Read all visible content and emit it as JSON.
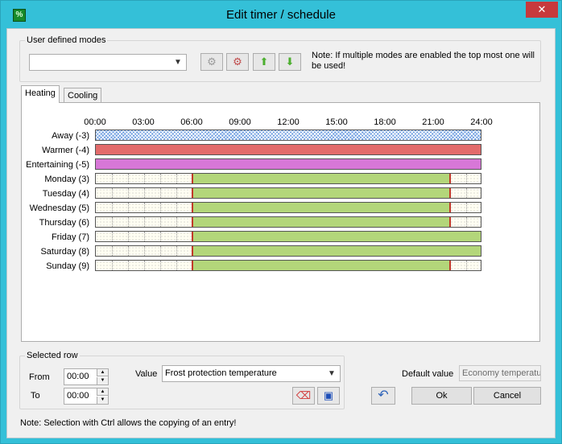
{
  "window": {
    "title": "Edit timer / schedule",
    "close_glyph": "✕",
    "app_icon_glyph": "%"
  },
  "modes": {
    "legend": "User defined modes",
    "combo_value": "",
    "note": "Note: If multiple modes are enabled the top most one will be used!",
    "buttons": [
      {
        "icon": "add-mode-icon",
        "glyph": "⚙"
      },
      {
        "icon": "delete-mode-icon",
        "glyph": "⚙"
      },
      {
        "icon": "arrow-up-icon",
        "glyph": "⬆"
      },
      {
        "icon": "arrow-down-icon",
        "glyph": "⬇"
      }
    ]
  },
  "tabs": [
    {
      "label": "Heating",
      "active": true
    },
    {
      "label": "Cooling",
      "active": false
    }
  ],
  "schedule": {
    "ticks": [
      "00:00",
      "03:00",
      "06:00",
      "09:00",
      "12:00",
      "15:00",
      "18:00",
      "21:00",
      "24:00"
    ],
    "colors": {
      "warmer": "#e36b6b",
      "entertaining": "#d777d7",
      "day": "#b3d67a",
      "edge": "#c23a2a"
    },
    "rows": [
      {
        "label": "Away (-3)",
        "segments": [
          {
            "start": 0,
            "end": 24,
            "style": "away"
          }
        ]
      },
      {
        "label": "Warmer (-4)",
        "segments": [
          {
            "start": 0,
            "end": 24,
            "style": "warmer"
          }
        ]
      },
      {
        "label": "Entertaining (-5)",
        "segments": [
          {
            "start": 0,
            "end": 24,
            "style": "entertaining"
          }
        ]
      },
      {
        "label": "Monday (3)",
        "segments": [
          {
            "start": 6,
            "end": 22,
            "style": "day"
          }
        ]
      },
      {
        "label": "Tuesday (4)",
        "segments": [
          {
            "start": 6,
            "end": 22,
            "style": "day"
          }
        ]
      },
      {
        "label": "Wednesday (5)",
        "segments": [
          {
            "start": 6,
            "end": 22,
            "style": "day"
          }
        ]
      },
      {
        "label": "Thursday (6)",
        "segments": [
          {
            "start": 6,
            "end": 22,
            "style": "day"
          }
        ]
      },
      {
        "label": "Friday (7)",
        "segments": [
          {
            "start": 6,
            "end": 24,
            "style": "day"
          }
        ]
      },
      {
        "label": "Saturday (8)",
        "segments": [
          {
            "start": 6,
            "end": 24,
            "style": "day"
          }
        ]
      },
      {
        "label": "Sunday (9)",
        "segments": [
          {
            "start": 6,
            "end": 22,
            "style": "day"
          }
        ]
      }
    ]
  },
  "selected_row": {
    "legend": "Selected row",
    "from_label": "From",
    "from_value": "00:00",
    "to_label": "To",
    "to_value": "00:00",
    "value_label": "Value",
    "value_selected": "Frost protection temperature",
    "eraser_glyph": "⌫",
    "select_glyph": "▣"
  },
  "default_value": {
    "label": "Default value",
    "value": "Economy temperature"
  },
  "buttons": {
    "undo_glyph": "↶",
    "ok": "Ok",
    "cancel": "Cancel"
  },
  "footer_note": "Note: Selection with Ctrl allows the copying of an entry!"
}
